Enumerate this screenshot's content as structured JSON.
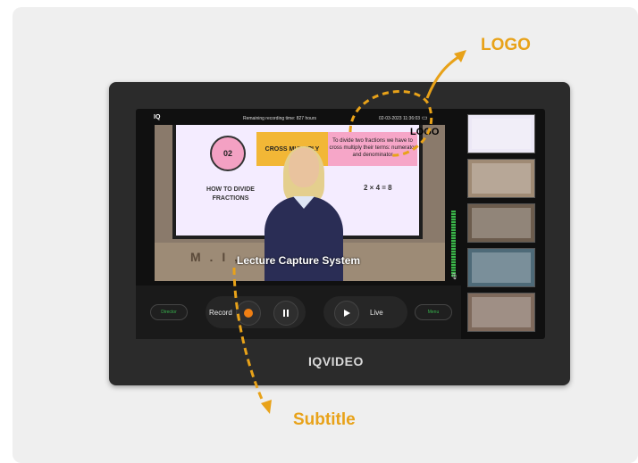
{
  "status_bar": {
    "logo_short": "IQ",
    "remaining": "Remaining recording time: 827 hours",
    "datetime": "02-03-2023 11:36:03"
  },
  "preview": {
    "board_circle": "02",
    "board_howto": "HOW TO DIVIDE FRACTIONS",
    "board_cross": "CROSS MULTIPLY",
    "board_divide": "To divide two fractions we have to cross multiply their terms: numerator and denominator",
    "board_math": "2 × 4 = 8",
    "logo_overlay": "LOGO",
    "subtitle": "Lecture Capture System"
  },
  "controls": {
    "director_label": "Director",
    "record_label": "Record",
    "live_label": "Live",
    "menu_label": "Menu"
  },
  "brand": "IQVIDEO",
  "annotations": {
    "logo": "LOGO",
    "subtitle": "Subtitle"
  },
  "colors": {
    "accent": "#e8a219",
    "record": "#f07f13",
    "green": "#37b24d",
    "device": "#2b2b2b"
  }
}
